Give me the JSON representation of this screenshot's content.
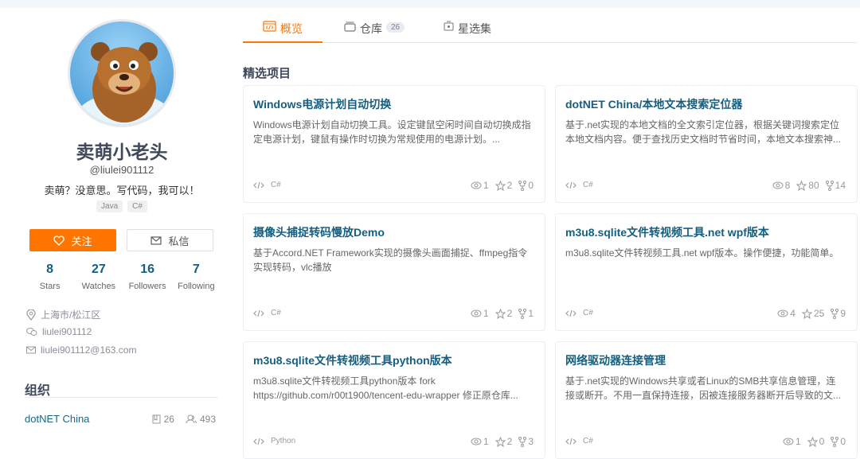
{
  "profile": {
    "name": "卖萌小老头",
    "handle": "@liulei901112",
    "bio": "卖萌？没意思。写代码，我可以！",
    "tags": [
      "Java",
      "C#"
    ],
    "follow_label": "关注",
    "message_label": "私信",
    "stats": [
      {
        "n": "8",
        "l": "Stars"
      },
      {
        "n": "27",
        "l": "Watches"
      },
      {
        "n": "16",
        "l": "Followers"
      },
      {
        "n": "7",
        "l": "Following"
      }
    ],
    "location": "上海市/松江区",
    "wechat": "liulei901112",
    "email": "liulei901112@163.com"
  },
  "orgs": {
    "heading": "组织",
    "items": [
      {
        "name": "dotNET China",
        "repos": "26",
        "members": "493"
      }
    ]
  },
  "tabs": [
    {
      "label": "概览"
    },
    {
      "label": "仓库",
      "badge": "26"
    },
    {
      "label": "星选集"
    }
  ],
  "section_title": "精选项目",
  "projects": [
    {
      "title": "Windows电源计划自动切换",
      "desc": "Windows电源计划自动切换工具。设定键鼠空闲时间自动切换成指定电源计划，键鼠有操作时切换为常规使用的电源计划。...",
      "lang": "C#",
      "watch": "1",
      "star": "2",
      "fork": "0"
    },
    {
      "title": "dotNET China/本地文本搜索定位器",
      "desc": "基于.net实现的本地文档的全文索引定位器，根据关键词搜索定位本地文档内容。便于查找历史文档时节省时间，本地文本搜索神...",
      "lang": "C#",
      "watch": "8",
      "star": "80",
      "fork": "14"
    },
    {
      "title": "摄像头捕捉转码慢放Demo",
      "desc": "基于Accord.NET Framework实现的摄像头画面捕捉、ffmpeg指令实现转码，vlc播放",
      "lang": "C#",
      "watch": "1",
      "star": "2",
      "fork": "1"
    },
    {
      "title": "m3u8.sqlite文件转视频工具.net wpf版本",
      "desc": "m3u8.sqlite文件转视频工具.net wpf版本。操作便捷，功能简单。",
      "lang": "C#",
      "watch": "4",
      "star": "25",
      "fork": "9"
    },
    {
      "title": "m3u8.sqlite文件转视频工具python版本",
      "desc": "m3u8.sqlite文件转视频工具python版本 fork https://github.com/r00t1900/tencent-edu-wrapper 修正原仓库...",
      "lang": "Python",
      "watch": "1",
      "star": "2",
      "fork": "3"
    },
    {
      "title": "网络驱动器连接管理",
      "desc": "基于.net实现的Windows共享或者Linux的SMB共享信息管理，连接或断开。不用一直保持连接，因被连接服务器断开后导致的文...",
      "lang": "C#",
      "watch": "1",
      "star": "0",
      "fork": "0"
    }
  ]
}
